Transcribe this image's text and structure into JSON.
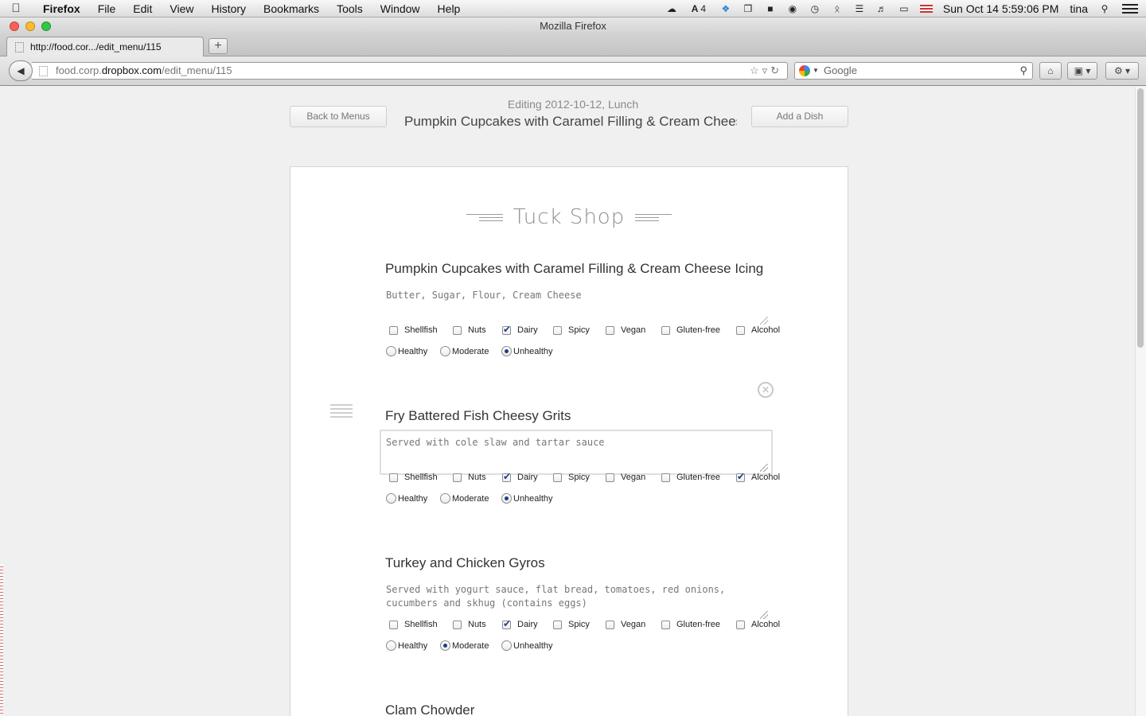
{
  "menubar": {
    "app_name": "Firefox",
    "items": [
      "File",
      "Edit",
      "View",
      "History",
      "Bookmarks",
      "Tools",
      "Window",
      "Help"
    ],
    "status_text_count": "4",
    "clock": "Sun Oct 14  5:59:06 PM",
    "user": "tina"
  },
  "window": {
    "title": "Mozilla Firefox"
  },
  "tab": {
    "label": "http://food.cor.../edit_menu/115",
    "new_tab_label": "+"
  },
  "urlbar": {
    "domain_prefix": "food.corp.",
    "domain": "dropbox.com",
    "path": "/edit_menu/115"
  },
  "search": {
    "placeholder": "Google"
  },
  "page": {
    "back_button": "Back to Menus",
    "add_button": "Add a Dish",
    "subtitle": "Editing 2012-10-12, Lunch",
    "title": "Pumpkin Cupcakes with Caramel Filling & Cream Cheese Icing",
    "brand": "Tuck Shop"
  },
  "labels": {
    "tags": [
      "Shellfish",
      "Nuts",
      "Dairy",
      "Spicy",
      "Vegan",
      "Gluten-free",
      "Alcohol"
    ],
    "health": [
      "Healthy",
      "Moderate",
      "Unhealthy"
    ]
  },
  "dishes": [
    {
      "name": "Pumpkin Cupcakes with Caramel Filling & Cream Cheese Icing",
      "description": "Butter, Sugar, Flour, Cream Cheese",
      "tags_checked": [
        false,
        false,
        true,
        false,
        false,
        false,
        false
      ],
      "health": "Unhealthy"
    },
    {
      "name": "Fry Battered Fish Cheesy Grits",
      "description": "Served with cole slaw and tartar sauce",
      "tags_checked": [
        false,
        false,
        true,
        false,
        false,
        false,
        true
      ],
      "health": "Unhealthy"
    },
    {
      "name": "Turkey and Chicken Gyros",
      "description": "Served with yogurt sauce, flat bread, tomatoes, red onions, cucumbers and skhug (contains eggs)",
      "tags_checked": [
        false,
        false,
        true,
        false,
        false,
        false,
        false
      ],
      "health": "Moderate"
    },
    {
      "name": "Clam Chowder"
    }
  ]
}
